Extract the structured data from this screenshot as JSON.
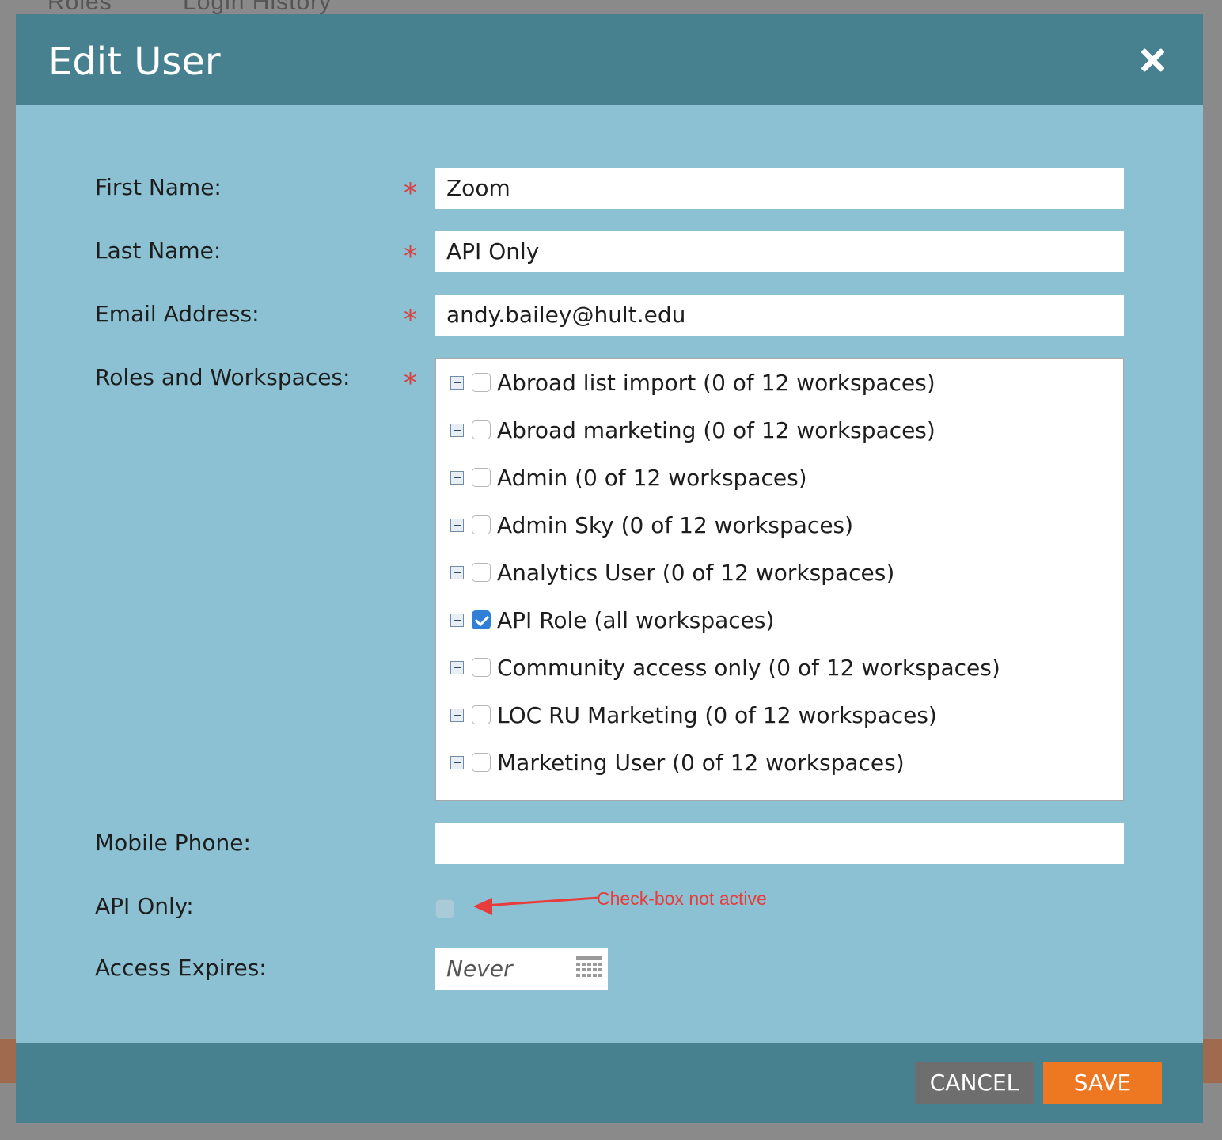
{
  "background": {
    "tabs": [
      "Roles",
      "Login History"
    ]
  },
  "modal": {
    "title": "Edit User",
    "close_icon": "close-icon"
  },
  "form": {
    "first_name": {
      "label": "First Name:",
      "value": "Zoom"
    },
    "last_name": {
      "label": "Last Name:",
      "value": "API Only"
    },
    "email": {
      "label": "Email Address:",
      "value": "andy.bailey@hult.edu"
    },
    "roles": {
      "label": "Roles and Workspaces:",
      "items": [
        {
          "label": "Abroad list import (0 of 12 workspaces)",
          "checked": false
        },
        {
          "label": "Abroad marketing (0 of 12 workspaces)",
          "checked": false
        },
        {
          "label": "Admin (0 of 12 workspaces)",
          "checked": false
        },
        {
          "label": "Admin Sky (0 of 12 workspaces)",
          "checked": false
        },
        {
          "label": "Analytics User (0 of 12 workspaces)",
          "checked": false
        },
        {
          "label": "API Role (all workspaces)",
          "checked": true
        },
        {
          "label": "Community access only (0 of 12 workspaces)",
          "checked": false
        },
        {
          "label": "LOC RU Marketing (0 of 12 workspaces)",
          "checked": false
        },
        {
          "label": "Marketing User (0 of 12 workspaces)",
          "checked": false
        }
      ]
    },
    "mobile_phone": {
      "label": "Mobile Phone:",
      "value": ""
    },
    "api_only": {
      "label": "API Only:",
      "checked": false,
      "annotation": "Check-box not active"
    },
    "access_expires": {
      "label": "Access Expires:",
      "placeholder": "Never"
    },
    "required_mark": "*"
  },
  "footer": {
    "cancel_label": "CANCEL",
    "save_label": "SAVE"
  },
  "colors": {
    "header": "#478190",
    "body": "#8bc1d3",
    "save": "#ee7721",
    "cancel": "#6e6e6e",
    "required": "#d94040",
    "annotation": "#e83b3b",
    "checked": "#2f7fd8"
  }
}
